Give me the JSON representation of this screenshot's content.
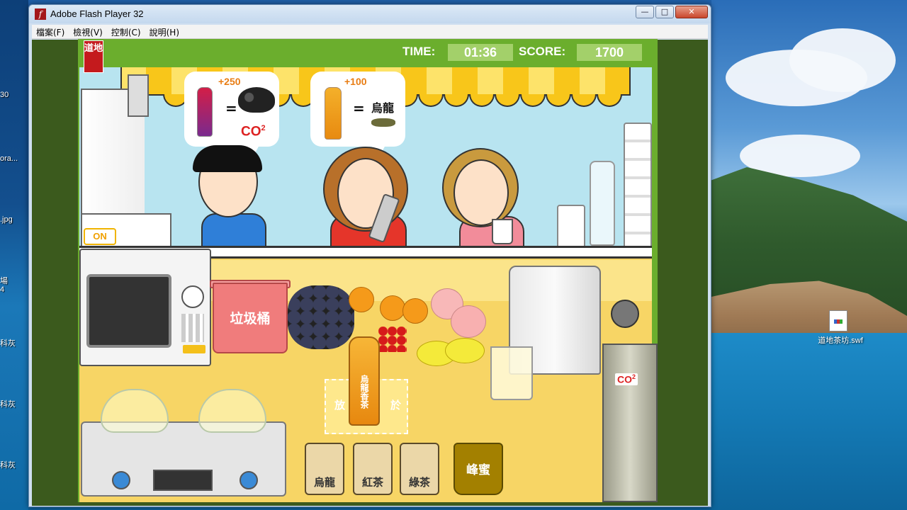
{
  "desktop": {
    "left_labels": [
      "30",
      "ora...",
      ".jpg",
      "場",
      "4",
      "科灰",
      "科灰",
      "科灰"
    ],
    "file_icon_label": "道地茶坊.swf"
  },
  "window": {
    "title": "Adobe Flash Player 32",
    "controls": {
      "minimize": "—",
      "maximize": "□",
      "close": "✕"
    },
    "menu": [
      "檔案(F)",
      "檢視(V)",
      "控制(C)",
      "說明(H)"
    ]
  },
  "game": {
    "hud": {
      "time_label": "TIME:",
      "time_value": "01:36",
      "score_label": "SCORE:",
      "score_value": "1700"
    },
    "logo_text": "道地",
    "orders": [
      {
        "points": "+250",
        "equals": "=",
        "ingredient": "grapes",
        "extra": "CO",
        "extra_sup": "2"
      },
      {
        "points": "+100",
        "equals": "=",
        "ingredient_label": "烏龍"
      }
    ],
    "machine_switch": "ON",
    "trash_label": "垃圾桶",
    "drop_zone": {
      "left": "放",
      "right": "於"
    },
    "bottle_label": "烏龍香茶",
    "tea_jars": [
      {
        "label": "烏龍"
      },
      {
        "label": "紅茶"
      },
      {
        "label": "綠茶"
      }
    ],
    "honey_label": "峰蜜",
    "tank_label": "CO",
    "tank_sup": "2"
  },
  "colors": {
    "stage_green": "#6bae2d",
    "awning_yellow": "#f8c61a",
    "points_orange": "#e87d14",
    "co2_red": "#dd2222"
  }
}
